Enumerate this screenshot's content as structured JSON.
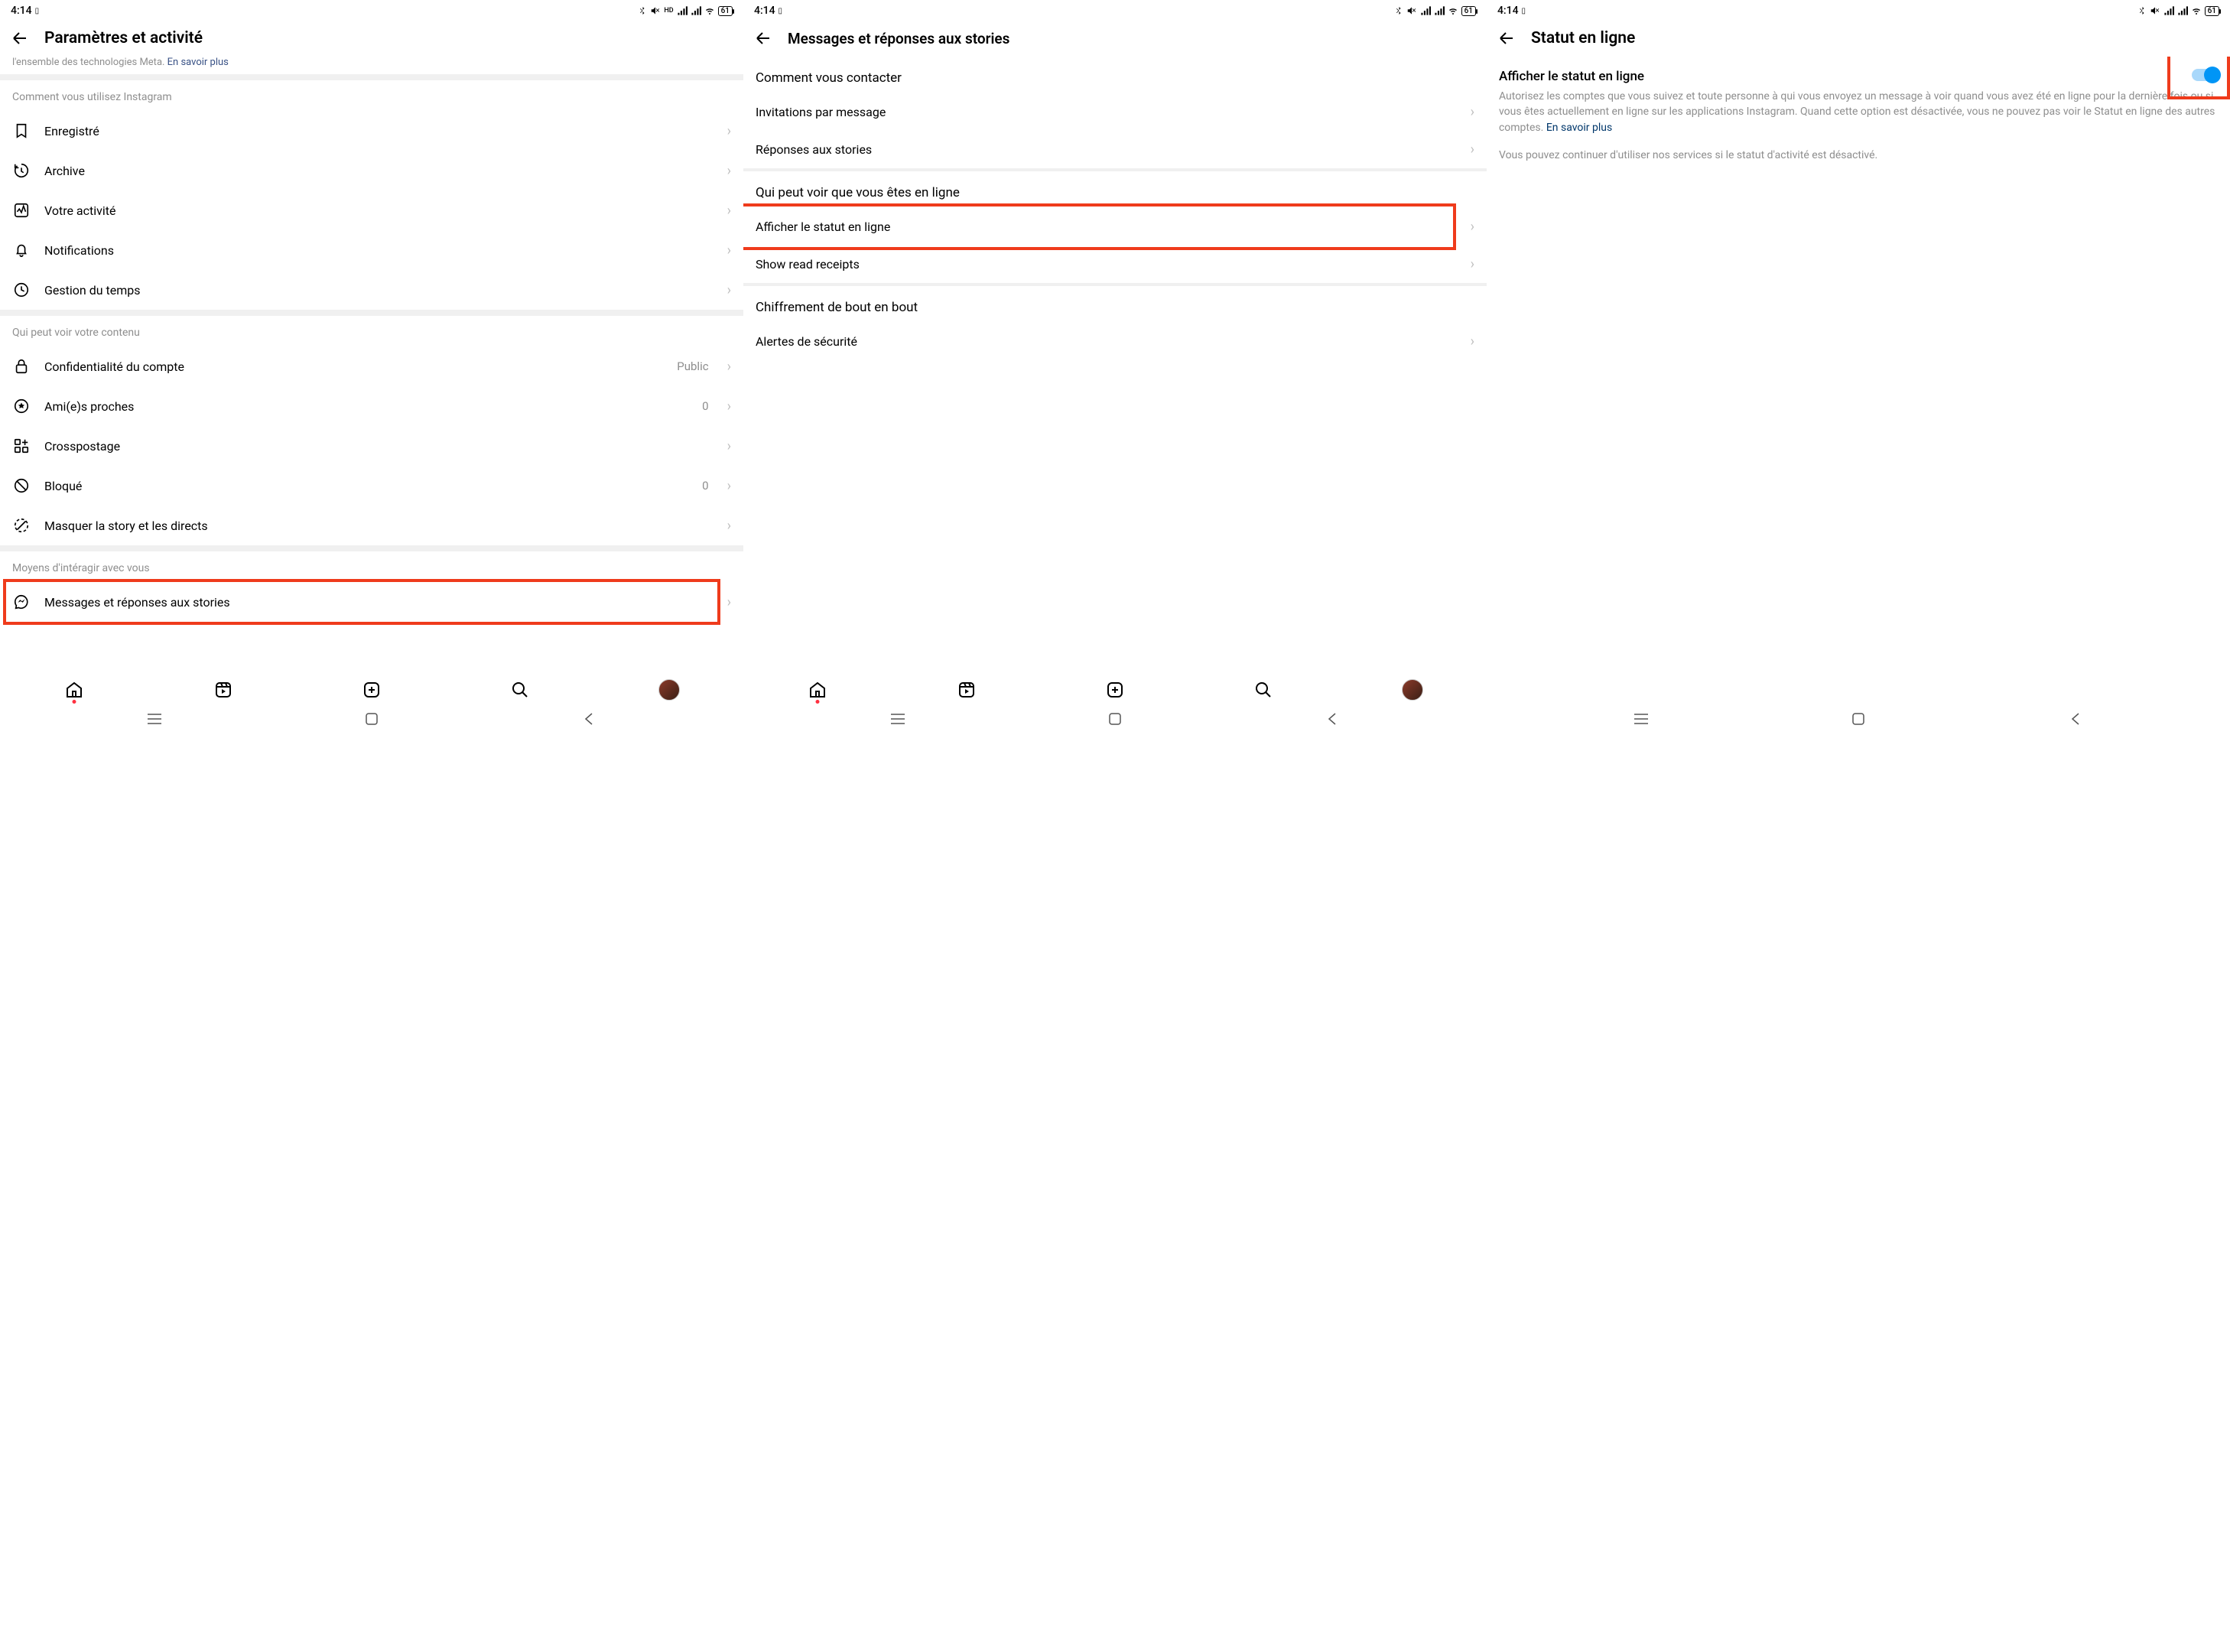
{
  "status": {
    "time": "4:14",
    "battery": "61"
  },
  "screen1": {
    "title": "Paramètres et activité",
    "cutoff_text": "l'ensemble des technologies Meta. ",
    "cutoff_link": "En savoir plus",
    "section_usage": "Comment vous utilisez Instagram",
    "items_usage": {
      "saved": "Enregistré",
      "archive": "Archive",
      "activity": "Votre activité",
      "notifications": "Notifications",
      "time": "Gestion du temps"
    },
    "section_visibility": "Qui peut voir votre contenu",
    "items_visibility": {
      "privacy": "Confidentialité du compte",
      "privacy_value": "Public",
      "close_friends": "Ami(e)s proches",
      "close_friends_value": "0",
      "crosspost": "Crosspostage",
      "blocked": "Bloqué",
      "blocked_value": "0",
      "hide_story": "Masquer la story et les directs"
    },
    "section_interact": "Moyens d'intéragir avec vous",
    "items_interact": {
      "messages": "Messages et réponses aux stories"
    }
  },
  "screen2": {
    "title": "Messages et réponses aux stories",
    "section_contact": "Comment vous contacter",
    "items_contact": {
      "invitations": "Invitations par message",
      "story_replies": "Réponses aux stories"
    },
    "section_online": "Qui peut voir que vous êtes en ligne",
    "items_online": {
      "activity_status": "Afficher le statut en ligne",
      "read_receipts": "Show read receipts"
    },
    "section_e2e": "Chiffrement de bout en bout",
    "items_e2e": {
      "security_alerts": "Alertes de sécurité"
    }
  },
  "screen3": {
    "title": "Statut en ligne",
    "toggle_label": "Afficher le statut en ligne",
    "desc1": "Autorisez les comptes que vous suivez et toute personne à qui vous envoyez un message à voir quand vous avez été en ligne pour la dernière fois ou si vous êtes actuellement en ligne sur les applications Instagram. Quand cette option est désactivée, vous ne pouvez pas voir le Statut en ligne des autres comptes. ",
    "learn_more": "En savoir plus",
    "desc2": "Vous pouvez continuer d'utiliser nos services si le statut d'activité est désactivé."
  }
}
